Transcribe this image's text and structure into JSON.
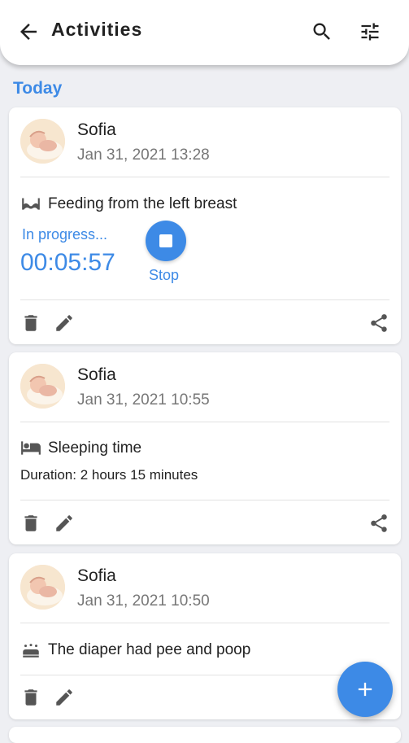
{
  "appbar": {
    "title": "Activities",
    "back_icon": "arrow-back-icon",
    "search_icon": "search-icon",
    "filter_icon": "tune-icon"
  },
  "section_title": "Today",
  "colors": {
    "accent": "#3d8ae6",
    "background": "#eeeff3"
  },
  "activities": [
    {
      "name": "Sofia",
      "time": "Jan 31, 2021 13:28",
      "icon": "bra-icon",
      "text": "Feeding from the left breast",
      "status": "In progress...",
      "timer": "00:05:57",
      "stop_label": "Stop"
    },
    {
      "name": "Sofia",
      "time": "Jan 31, 2021 10:55",
      "icon": "bed-icon",
      "text": "Sleeping time",
      "duration": "Duration: 2 hours 15 minutes"
    },
    {
      "name": "Sofia",
      "time": "Jan 31, 2021 10:50",
      "icon": "diaper-icon",
      "text": "The diaper had pee and poop"
    }
  ],
  "fab_icon": "add-icon"
}
